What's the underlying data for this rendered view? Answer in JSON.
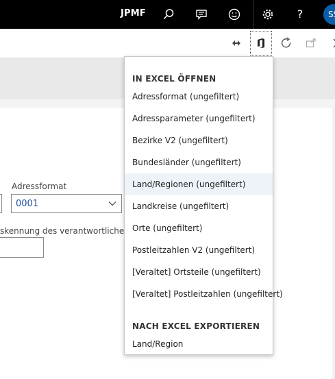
{
  "header": {
    "company": "JPMF",
    "avatar_initials": "SS",
    "icons": [
      "search-icon",
      "message-icon",
      "smiley-icon",
      "gear-icon",
      "help-icon"
    ]
  },
  "actionbar": {
    "icons": [
      "diamond-arrows-icon",
      "office-icon",
      "refresh-icon",
      "open-new-icon",
      "close-icon"
    ]
  },
  "form": {
    "address_format_label": "Adressformat",
    "address_format_value": "0001",
    "responsible_label": "skennung des verantwortlichen ..."
  },
  "menu": {
    "open_header": "IN EXCEL ÖFFNEN",
    "open_items": [
      "Adressformat (ungefiltert)",
      "Adressparameter (ungefiltert)",
      "Bezirke V2 (ungefiltert)",
      "Bundesländer (ungefiltert)",
      "Land/Regionen (ungefiltert)",
      "Landkreise (ungefiltert)",
      "Orte (ungefiltert)",
      "Postleitzahlen V2 (ungefiltert)",
      "[Veraltet] Ortsteile (ungefiltert)",
      "[Veraltet] Postleitzahlen (ungefiltert)"
    ],
    "highlighted_index": 4,
    "export_header": "NACH EXCEL EXPORTIEREN",
    "export_items": [
      "Land/Region"
    ]
  },
  "colors": {
    "topbar": "#000000",
    "accent_value": "#1f4fa3",
    "highlight": "#eef3fa",
    "avatar": "#0b5ea8"
  }
}
